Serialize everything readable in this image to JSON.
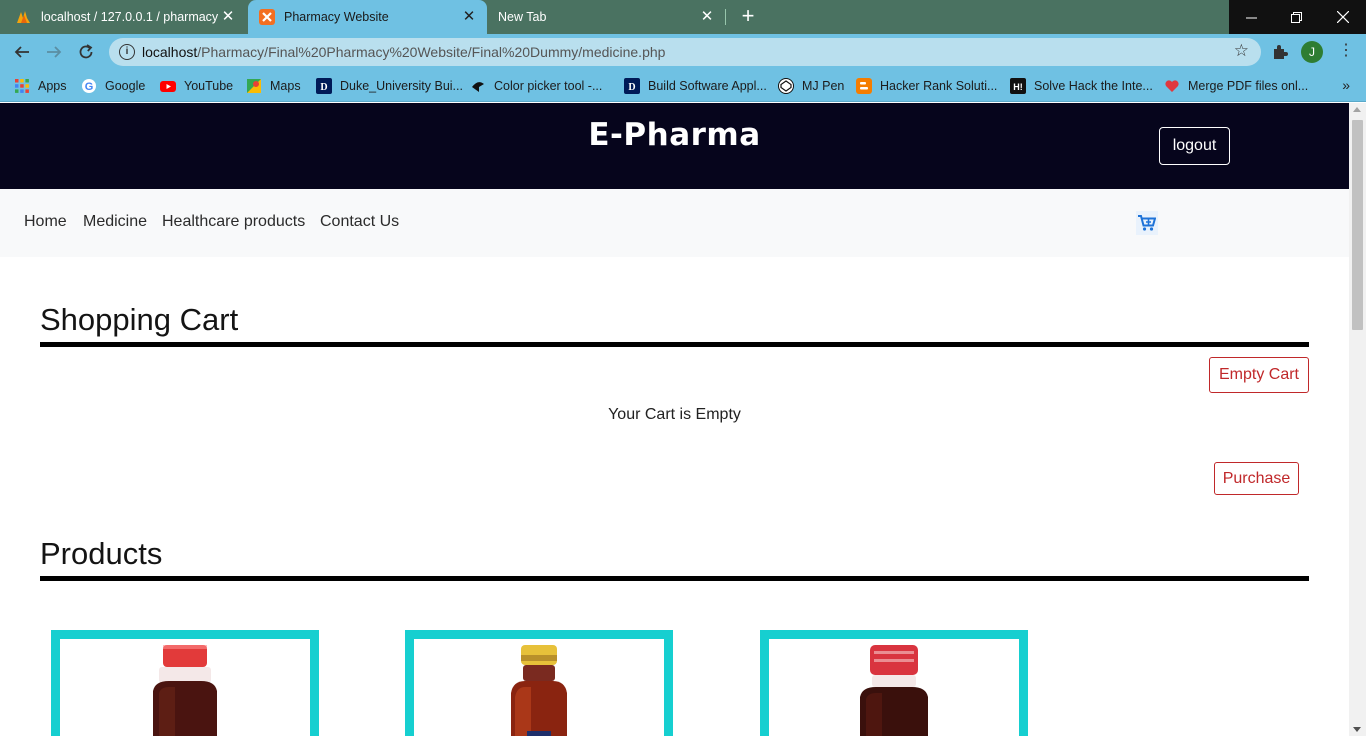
{
  "browser": {
    "tabs": [
      {
        "title": "localhost / 127.0.0.1 / pharmacy /",
        "state": "inactive"
      },
      {
        "title": "Pharmacy Website",
        "state": "active"
      },
      {
        "title": "New Tab",
        "state": "inactive"
      }
    ],
    "new_tab": "+",
    "address": {
      "host": "localhost",
      "path": "/Pharmacy/Final%20Pharmacy%20Website/Final%20Dummy/medicine.php"
    },
    "profile_initial": "J",
    "bookmarks": [
      {
        "label": "Apps",
        "icon": "apps-grid-icon",
        "color": "#e94235"
      },
      {
        "label": "Google",
        "icon": "google-icon",
        "color": "#4285f4"
      },
      {
        "label": "YouTube",
        "icon": "youtube-icon",
        "color": "#ff0000"
      },
      {
        "label": "Maps",
        "icon": "maps-icon",
        "color": "#34a853"
      },
      {
        "label": "Duke_University Bui...",
        "icon": "duke-icon",
        "color": "#001a57"
      },
      {
        "label": "Color picker tool -...",
        "icon": "color-picker-icon",
        "color": "#111111"
      },
      {
        "label": "Build Software Appl...",
        "icon": "duke-icon",
        "color": "#001a57"
      },
      {
        "label": "MJ Pen",
        "icon": "codepen-icon",
        "color": "#111111"
      },
      {
        "label": "Hacker Rank Soluti...",
        "icon": "blogger-icon",
        "color": "#f57d00"
      },
      {
        "label": "Solve Hack the Inte...",
        "icon": "hackerrank-icon",
        "color": "#111111"
      },
      {
        "label": "Merge PDF files onl...",
        "icon": "heart-icon",
        "color": "#e0383e"
      }
    ],
    "bookmarks_more": "»"
  },
  "site": {
    "brand": "E-Pharma",
    "logout_label": "logout",
    "nav": [
      "Home",
      "Medicine",
      "Healthcare products",
      "Contact Us"
    ],
    "cart_icon": "cart-plus-icon",
    "accent_color": "#16cfd0",
    "danger_color": "#c0282a"
  },
  "cart": {
    "title": "Shopping Cart",
    "empty_button": "Empty Cart",
    "empty_message": "Your Cart is Empty",
    "purchase_button": "Purchase"
  },
  "products": {
    "title": "Products",
    "items": [
      {
        "cap_color": "#e23a3a",
        "bottle": "medicine-bottle-1"
      },
      {
        "cap_color": "#e7c13a",
        "bottle": "medicine-bottle-2"
      },
      {
        "cap_color": "#d9343f",
        "bottle": "medicine-bottle-3"
      }
    ]
  }
}
